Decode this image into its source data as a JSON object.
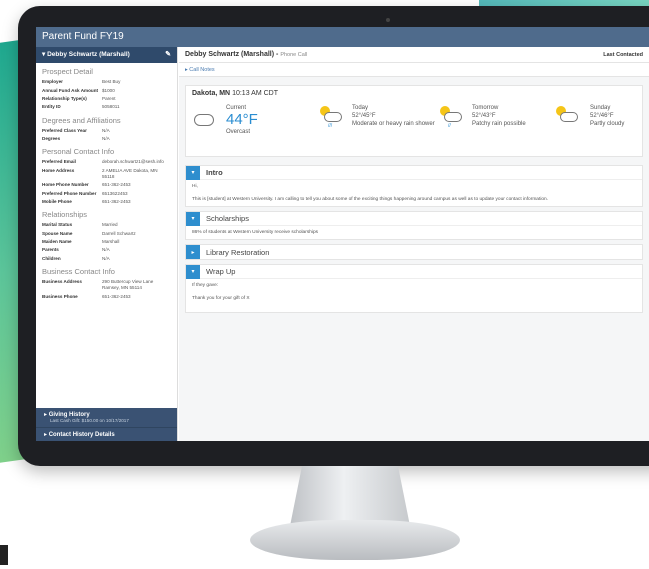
{
  "window_title": "Parent Fund FY19",
  "sidebar": {
    "header": "Debby Schwartz (Marshall)",
    "sections": [
      {
        "title": "Prospect Detail",
        "rows": [
          {
            "k": "Employer",
            "v": "Best Buy"
          },
          {
            "k": "Annual Fund Ask Amount",
            "v": "$1000"
          },
          {
            "k": "Relationship Type(s)",
            "v": "Parent"
          },
          {
            "k": "Entity ID",
            "v": "5058011"
          }
        ]
      },
      {
        "title": "Degrees and Affiliations",
        "rows": [
          {
            "k": "Preferred Class Year",
            "v": "N/A"
          },
          {
            "k": "Degrees",
            "v": "N/A"
          }
        ]
      },
      {
        "title": "Personal Contact Info",
        "rows": [
          {
            "k": "Preferred Email",
            "v": "deborah.schwartz1@sesh.info"
          },
          {
            "k": "Home Address",
            "v": "2 AMELIA AVE Dakota, MN 55118"
          },
          {
            "k": "Home Phone Number",
            "v": "651-362-2453"
          },
          {
            "k": "Preferred Phone Number",
            "v": "6513622453"
          },
          {
            "k": "Mobile Phone",
            "v": "651-362-2453"
          }
        ]
      },
      {
        "title": "Relationships",
        "rows": [
          {
            "k": "Marital Status",
            "v": "Married"
          },
          {
            "k": "Spouse Name",
            "v": "Darrell Schwartz"
          },
          {
            "k": "Maiden Name",
            "v": "Marshall"
          },
          {
            "k": "Parents",
            "v": "N/A"
          },
          {
            "k": "Children",
            "v": "N/A"
          }
        ]
      },
      {
        "title": "Business Contact Info",
        "rows": [
          {
            "k": "Business Address",
            "v": "290 Buttercup View Lane Ramsey, MN 55114"
          },
          {
            "k": "Business Phone",
            "v": "651-362-2453"
          }
        ]
      }
    ],
    "giving_history": "Giving History",
    "last_gift": "Last Cash Gift: $150.00 on 10/17/2017",
    "contact_history": "Contact History Details"
  },
  "main": {
    "name": "Debby Schwartz (Marshall) -",
    "call_type": "Phone Call",
    "last_contacted": "Last Contacted",
    "call_notes": "Call Notes",
    "weather": {
      "location": "Dakota, MN",
      "time": "10:13 AM CDT",
      "current_label": "Current",
      "current_temp": "44°F",
      "current_desc": "Overcast",
      "days": [
        {
          "label": "Today",
          "temp": "52°/45°F",
          "desc": "Moderate or heavy rain shower"
        },
        {
          "label": "Tomorrow",
          "temp": "52°/43°F",
          "desc": "Patchy rain possible"
        },
        {
          "label": "Sunday",
          "temp": "52°/46°F",
          "desc": "Partly cloudy"
        }
      ]
    },
    "panels": [
      {
        "title": "Intro",
        "lines": [
          "Hi,",
          "This is [student] at Western University. I am calling to tell you about some of the exciting things happening around campus as well as to update your contact information."
        ]
      },
      {
        "title": "Scholarships",
        "lines": [
          "86% of students at Western University receive scholarships"
        ]
      },
      {
        "title": "Library Restoration",
        "lines": []
      },
      {
        "title": "Wrap Up",
        "lines": [
          "If they gave:",
          "Thank you for your gift of X"
        ]
      }
    ]
  }
}
